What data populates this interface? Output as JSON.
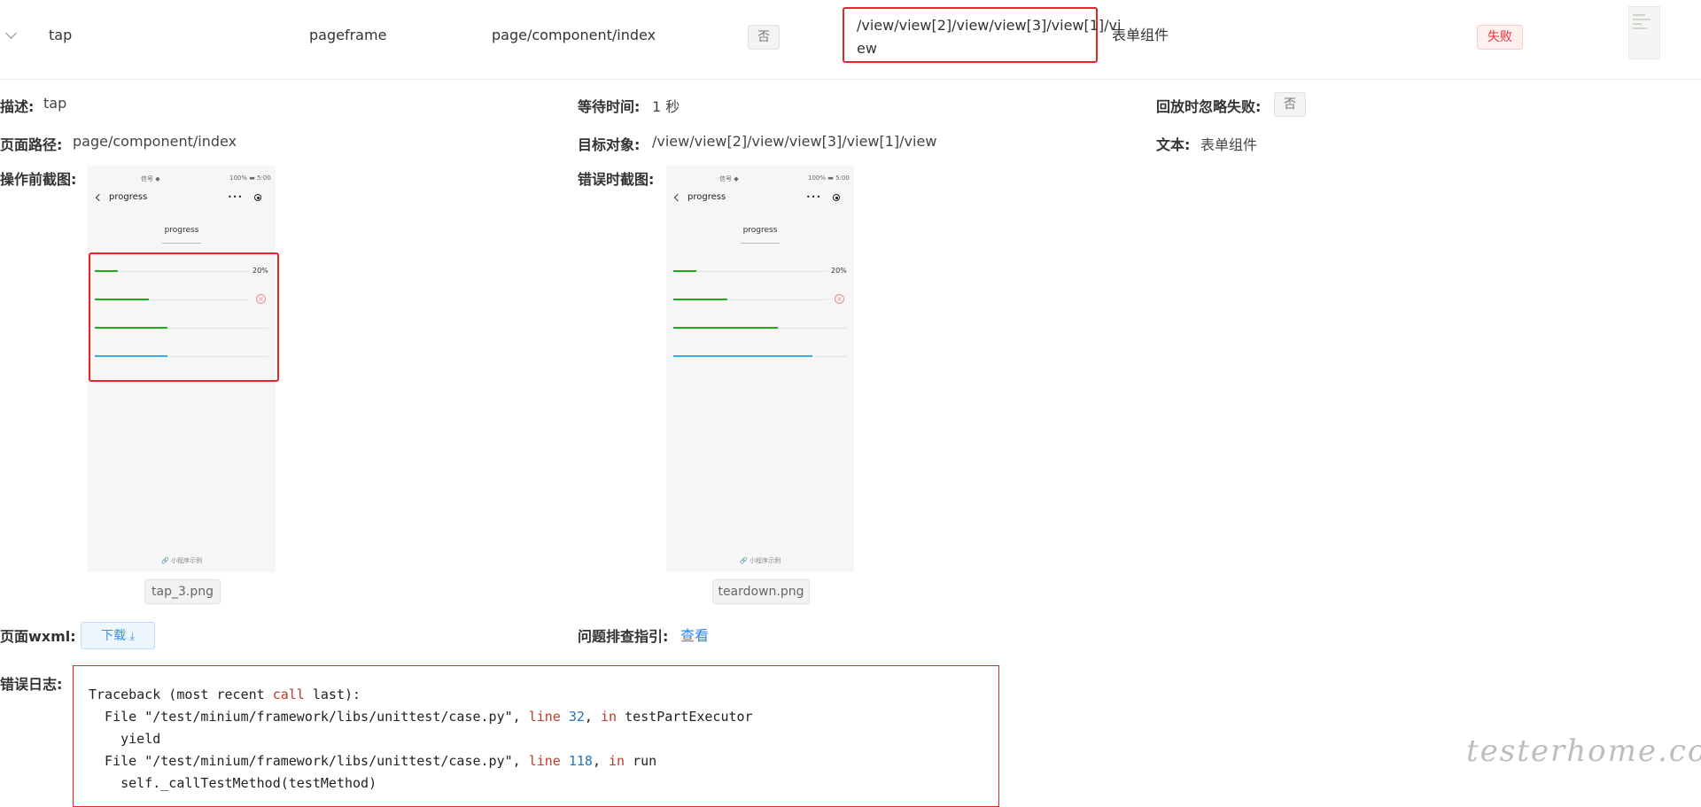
{
  "row": {
    "action": "tap",
    "module": "pageframe",
    "page_path": "page/component/index",
    "ignore_fail": "否",
    "target": "/view/view[2]/view/view[3]/view[1]/view",
    "target_line1": "/view/view[2]/view/view[3]/view[1]/vi",
    "target_line2": "ew",
    "text": "表单组件",
    "status": "失败",
    "status_color": "#ee3333"
  },
  "detail": {
    "desc_label": "描述:",
    "desc_value": "tap",
    "wait_label": "等待时间:",
    "wait_value": "1 秒",
    "ignore_label": "回放时忽略失败:",
    "ignore_value": "否",
    "path_label": "页面路径:",
    "path_value": "page/component/index",
    "target_label": "目标对象:",
    "target_value": "/view/view[2]/view/view[3]/view[1]/view",
    "text_label": "文本:",
    "text_value": "表单组件",
    "before_label": "操作前截图:",
    "error_label": "错误时截图:",
    "wxml_label": "页面wxml:",
    "download_label": "下载",
    "guide_label": "问题排查指引:",
    "guide_link": "查看",
    "log_label": "错误日志:"
  },
  "screenshots": {
    "before": {
      "file": "tap_3.png",
      "status_left": "信号 ◆",
      "status_right": "100% ▬ 5:00",
      "title": "progress",
      "capsule": "•••",
      "tab": "progress",
      "percent": "20%",
      "x_mark": "×",
      "footer": "🔗 小程序示例",
      "bars": [
        0.15,
        0.35,
        0.42,
        0.42
      ]
    },
    "error": {
      "file": "teardown.png",
      "status_left": "信号 ◆",
      "status_right": "100% ▬ 5:00",
      "title": "progress",
      "capsule": "•••",
      "tab": "progress",
      "percent": "20%",
      "x_mark": "×",
      "footer": "🔗 小程序示例",
      "bars": [
        0.15,
        0.35,
        0.6,
        0.8
      ]
    },
    "bar_colors": [
      "#1aad19",
      "#1aad19",
      "#1aad19",
      "#3aa9ee"
    ]
  },
  "log": {
    "line1_a": "Traceback (most recent ",
    "line1_kw": "call",
    "line1_b": " last):",
    "line2_a": "  File \"/test/minium/framework/libs/unittest/case.py\", ",
    "line2_kw1": "line",
    "line2_num": "32",
    "line2_kw2": "in",
    "line2_b": " testPartExecutor",
    "line3": "    yield",
    "line4_a": "  File \"/test/minium/framework/libs/unittest/case.py\", ",
    "line4_kw1": "line",
    "line4_num": "118",
    "line4_kw2": "in",
    "line4_b": " run",
    "line5": "    self._callTestMethod(testMethod)"
  },
  "watermark": "testerhome.com"
}
